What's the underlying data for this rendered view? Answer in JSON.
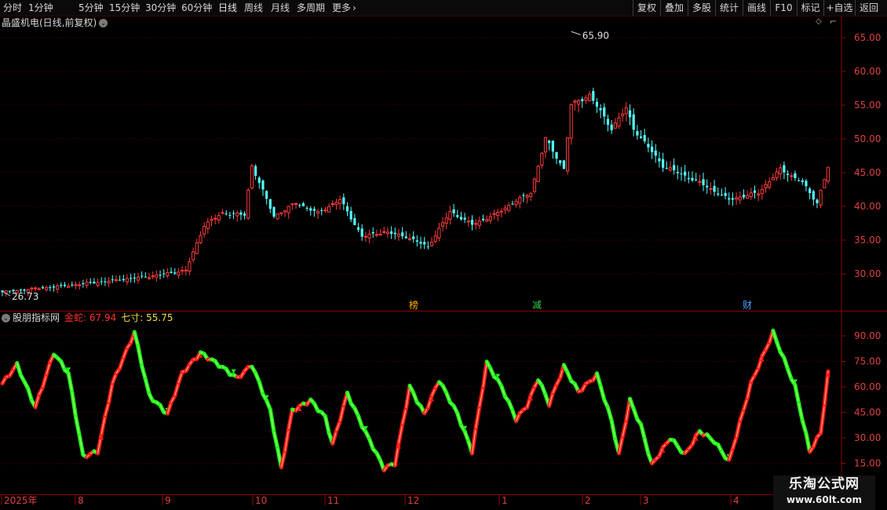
{
  "toolbar": {
    "periods": [
      "分时",
      "1分钟",
      "5分钟",
      "15分钟",
      "30分钟",
      "60分钟",
      "日线",
      "周线",
      "月线",
      "多周期",
      "更多"
    ],
    "active_period": "日线",
    "right_buttons": [
      "复权",
      "叠加",
      "多股",
      "统计",
      "画线",
      "F10",
      "标记",
      "+自选",
      "返回"
    ]
  },
  "price_panel": {
    "title": "晶盛机电(日线,前复权)",
    "axis_labels": [
      "65.00",
      "60.00",
      "55.00",
      "50.00",
      "45.00",
      "40.00",
      "35.00",
      "30.00"
    ],
    "high_marker": "65.90",
    "low_marker": "26.73",
    "event_marks": [
      {
        "text": "减",
        "color": "#37d04a",
        "date_index": 4
      },
      {
        "text": "榜",
        "color": "#ffb000",
        "date_index": 5
      },
      {
        "text": "财",
        "color": "#4aa0ff",
        "date_index": 7
      }
    ],
    "up_color": "#ff3a3a",
    "down_color": "#54ffff"
  },
  "indicator_panel": {
    "name": "股朋指标网",
    "line1_label": "金蛇:",
    "line1_value": "67.94",
    "line2_label": "七寸:",
    "line2_value": "55.75",
    "axis_labels": [
      "90.00",
      "75.00",
      "60.00",
      "45.00",
      "30.00",
      "15.00"
    ],
    "rise_color": "#ff1a1a",
    "fall_color": "#1aff1a"
  },
  "date_axis": [
    "2025年",
    "8",
    "9",
    "10",
    "11",
    "12",
    "1",
    "2",
    "3",
    "4"
  ],
  "watermark": {
    "line1": "乐淘公式网",
    "line2": "www.60lt.com"
  },
  "chart_data": {
    "type": "candlestick",
    "title": "晶盛机电(日线,前复权)",
    "ylim": [
      25,
      67
    ],
    "price_high": 65.9,
    "price_low": 26.73,
    "close_waypoints": [
      [
        0,
        27.3
      ],
      [
        20,
        28.4
      ],
      [
        40,
        29.6
      ],
      [
        50,
        30.5
      ],
      [
        55,
        37.2
      ],
      [
        60,
        39.0
      ],
      [
        66,
        38.7
      ],
      [
        68,
        46.0
      ],
      [
        74,
        38.5
      ],
      [
        80,
        40.5
      ],
      [
        86,
        39.0
      ],
      [
        92,
        41.0
      ],
      [
        98,
        35.5
      ],
      [
        104,
        36.2
      ],
      [
        110,
        35.5
      ],
      [
        116,
        34.0
      ],
      [
        122,
        39.2
      ],
      [
        128,
        37.3
      ],
      [
        134,
        38.7
      ],
      [
        140,
        40.8
      ],
      [
        144,
        42.0
      ],
      [
        148,
        50.0
      ],
      [
        153,
        45.5
      ],
      [
        155,
        55.0
      ],
      [
        160,
        56.5
      ],
      [
        166,
        51.5
      ],
      [
        170,
        54.5
      ],
      [
        172,
        51.5
      ],
      [
        180,
        46.0
      ],
      [
        190,
        43.5
      ],
      [
        198,
        41.0
      ],
      [
        206,
        42.0
      ],
      [
        212,
        45.5
      ],
      [
        218,
        43.5
      ],
      [
        222,
        40.5
      ],
      [
        225,
        45.8
      ]
    ],
    "oscillator": {
      "name": "金蛇",
      "ylim": [
        10,
        95
      ],
      "last_values": {
        "金蛇": 67.94,
        "七寸": 55.75
      },
      "waypoints": [
        [
          0,
          62
        ],
        [
          4,
          73
        ],
        [
          9,
          48
        ],
        [
          14,
          80
        ],
        [
          18,
          68
        ],
        [
          22,
          19
        ],
        [
          26,
          22
        ],
        [
          30,
          62
        ],
        [
          36,
          92
        ],
        [
          40,
          55
        ],
        [
          45,
          44
        ],
        [
          49,
          68
        ],
        [
          54,
          80
        ],
        [
          59,
          73
        ],
        [
          64,
          65
        ],
        [
          68,
          73
        ],
        [
          73,
          46
        ],
        [
          76,
          12
        ],
        [
          79,
          46
        ],
        [
          84,
          52
        ],
        [
          88,
          42
        ],
        [
          90,
          26
        ],
        [
          94,
          56
        ],
        [
          99,
          33
        ],
        [
          104,
          12
        ],
        [
          107,
          15
        ],
        [
          111,
          60
        ],
        [
          115,
          44
        ],
        [
          119,
          64
        ],
        [
          124,
          44
        ],
        [
          128,
          22
        ],
        [
          132,
          74
        ],
        [
          136,
          60
        ],
        [
          140,
          41
        ],
        [
          143,
          49
        ],
        [
          146,
          65
        ],
        [
          149,
          50
        ],
        [
          153,
          72
        ],
        [
          157,
          57
        ],
        [
          162,
          67
        ],
        [
          166,
          40
        ],
        [
          168,
          20
        ],
        [
          171,
          52
        ],
        [
          174,
          37
        ],
        [
          177,
          14
        ],
        [
          182,
          30
        ],
        [
          186,
          20
        ],
        [
          190,
          34
        ],
        [
          194,
          28
        ],
        [
          198,
          16
        ],
        [
          204,
          62
        ],
        [
          210,
          92
        ],
        [
          216,
          60
        ],
        [
          220,
          22
        ],
        [
          223,
          33
        ],
        [
          225,
          68
        ]
      ]
    }
  }
}
